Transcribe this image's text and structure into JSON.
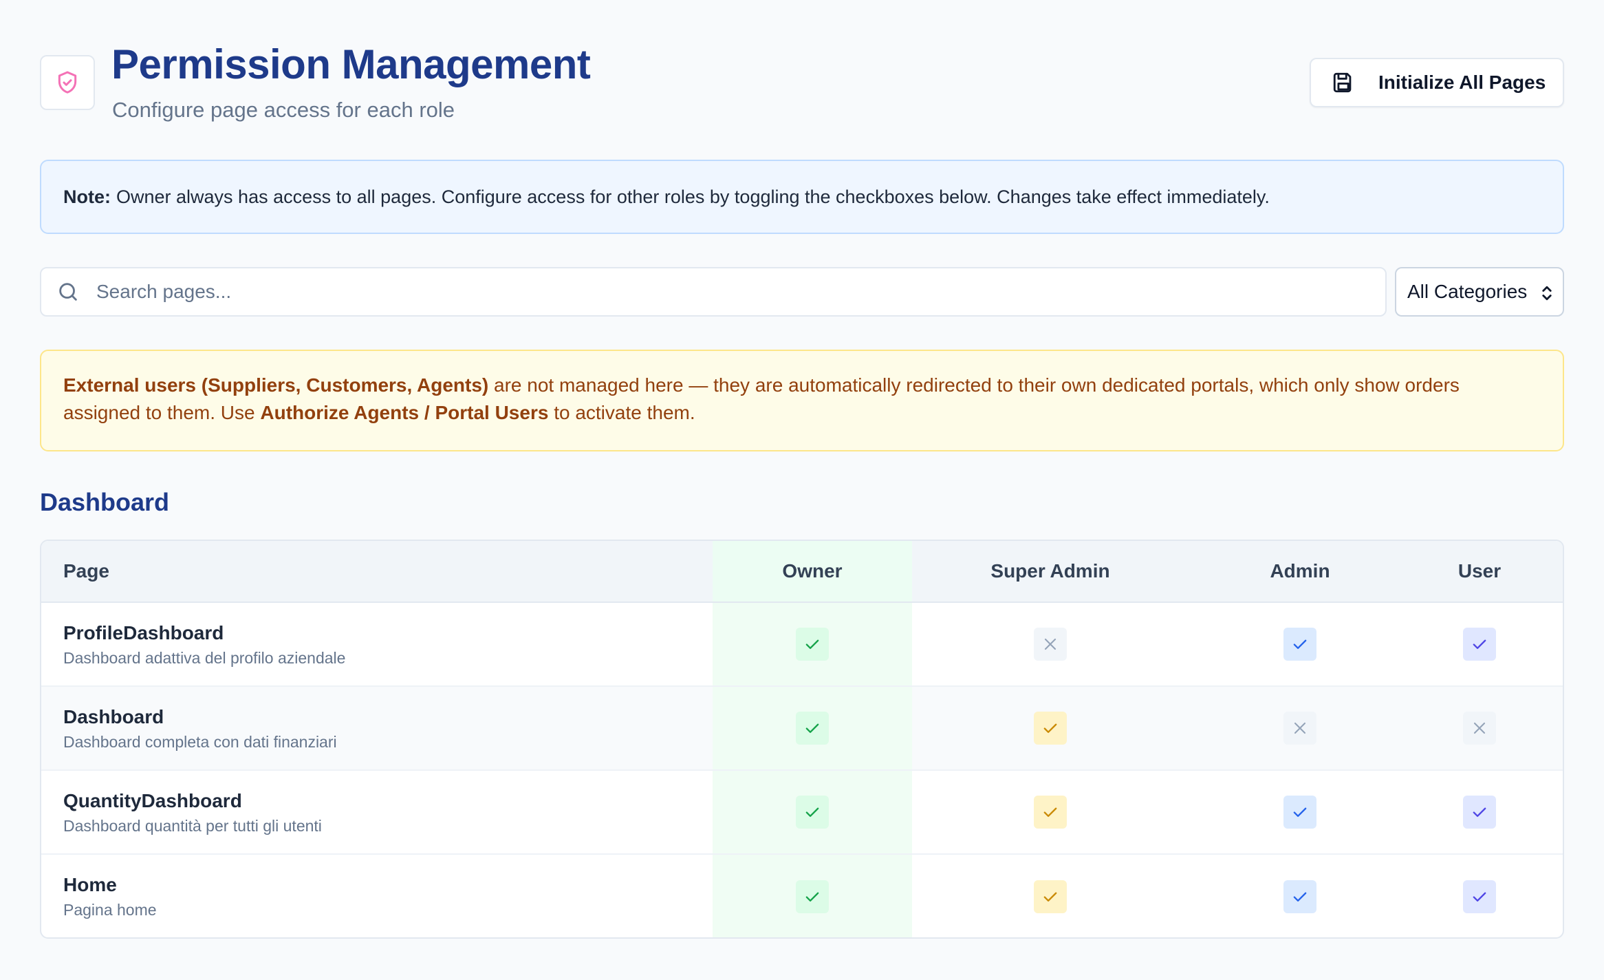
{
  "header": {
    "title": "Permission Management",
    "subtitle": "Configure page access for each role",
    "logo_icon": "shield-check-icon",
    "init_button_label": "Initialize All Pages",
    "init_button_icon": "save-icon"
  },
  "note": {
    "label": "Note:",
    "text": "Owner always has access to all pages. Configure access for other roles by toggling the checkboxes below. Changes take effect immediately."
  },
  "search": {
    "placeholder": "Search pages...",
    "value": ""
  },
  "category_select": {
    "selected": "All Categories"
  },
  "warning": {
    "bold_1": "External users (Suppliers, Customers, Agents)",
    "text_1": " are not managed here — they are automatically redirected to their own dedicated portals, which only show orders assigned to them. Use ",
    "bold_2": "Authorize Agents / Portal Users",
    "text_2": " to activate them."
  },
  "section": {
    "title": "Dashboard"
  },
  "table": {
    "headers": [
      "Page",
      "Owner",
      "Super Admin",
      "Admin",
      "User"
    ],
    "rows": [
      {
        "name": "ProfileDashboard",
        "description": "Dashboard adattiva del profilo aziendale",
        "owner": true,
        "super_admin": false,
        "admin": true,
        "user": true
      },
      {
        "name": "Dashboard",
        "description": "Dashboard completa con dati finanziari",
        "owner": true,
        "super_admin": true,
        "admin": false,
        "user": false
      },
      {
        "name": "QuantityDashboard",
        "description": "Dashboard quantità per tutti gli utenti",
        "owner": true,
        "super_admin": true,
        "admin": true,
        "user": true
      },
      {
        "name": "Home",
        "description": "Pagina home",
        "owner": true,
        "super_admin": true,
        "admin": true,
        "user": true
      }
    ]
  },
  "colors": {
    "title": "#1e3a8a",
    "owner_check": "#16a34a",
    "super_admin_check": "#ca8a04",
    "admin_check": "#2563eb",
    "user_check": "#4f46e5",
    "unchecked": "#94a3b8"
  }
}
